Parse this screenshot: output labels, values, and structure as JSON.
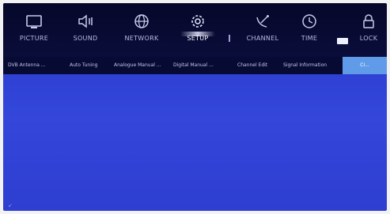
{
  "menu": [
    {
      "label": "PICTURE",
      "icon": "picture-icon"
    },
    {
      "label": "SOUND",
      "icon": "speaker-icon"
    },
    {
      "label": "NETWORK",
      "icon": "globe-icon"
    },
    {
      "label": "SETUP",
      "icon": "gear-icon"
    },
    {
      "label": "CHANNEL",
      "icon": "satellite-dish-icon"
    },
    {
      "label": "TIME",
      "icon": "clock-icon"
    },
    {
      "label": "LOCK",
      "icon": "lock-icon"
    }
  ],
  "active_menu": "SETUP",
  "submenu": [
    {
      "label": "DVB Antenna ..."
    },
    {
      "label": "Auto Tuning"
    },
    {
      "label": "Analogue Manual ..."
    },
    {
      "label": "Digital Manual ..."
    },
    {
      "label": "Channel Edit"
    },
    {
      "label": "Signal Information"
    },
    {
      "label": "CI..."
    }
  ],
  "colors": {
    "screen_bg": "#2f3fd6",
    "menu_bg": "#06072a",
    "selected_bg": "#5f9be8"
  }
}
